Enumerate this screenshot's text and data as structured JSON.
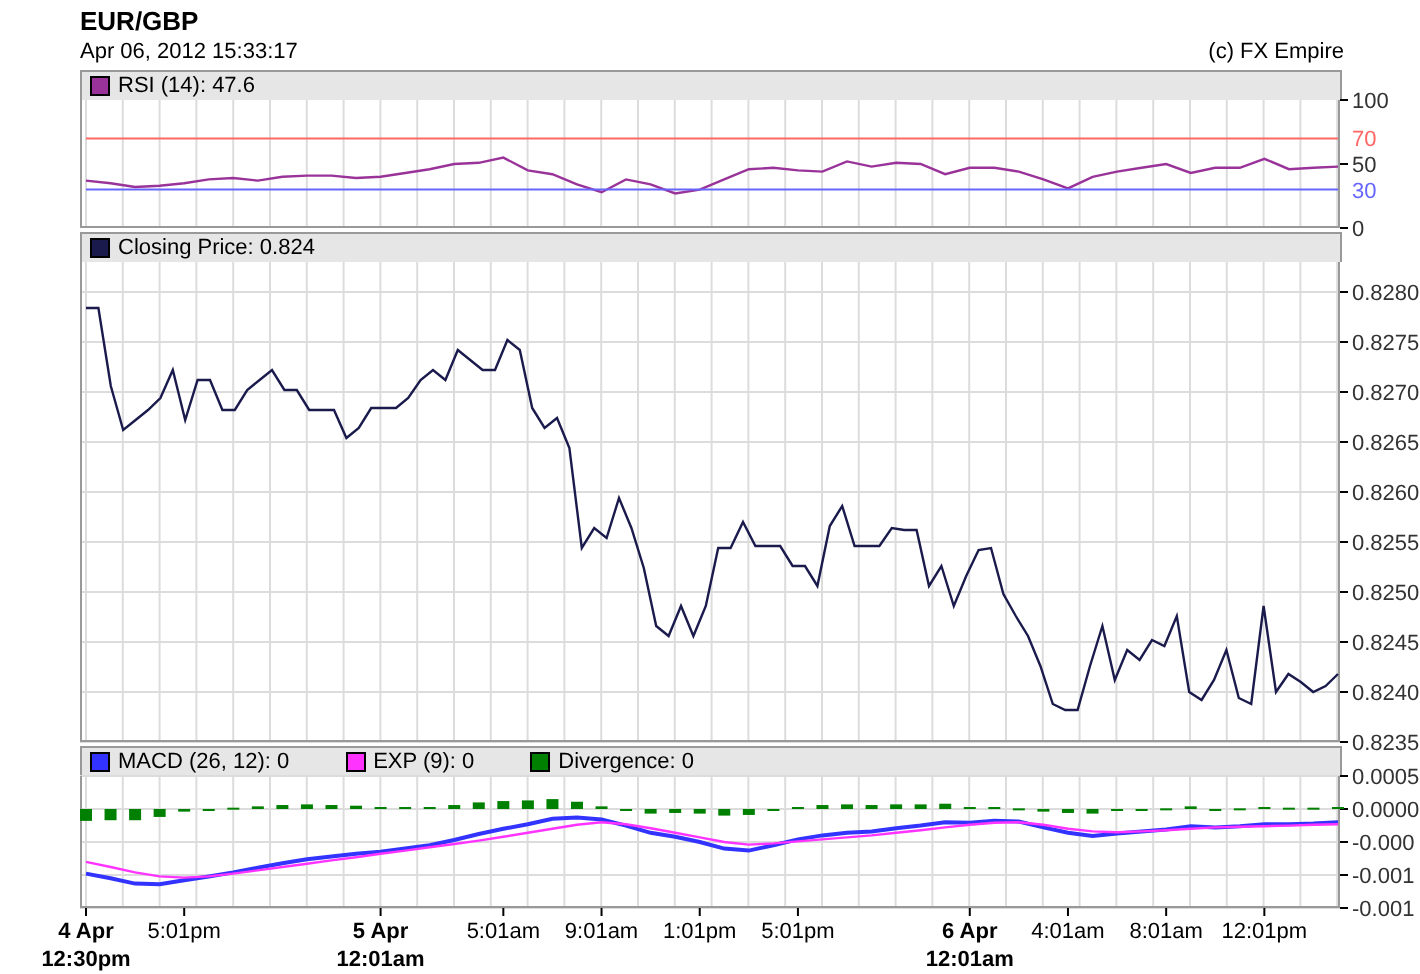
{
  "header": {
    "title": "EUR/GBP",
    "timestamp": "Apr 06, 2012 15:33:17",
    "copyright": "(c) FX Empire"
  },
  "panels": [
    {
      "chart_data": {
        "type": "line",
        "grid": true,
        "ylim": [
          0,
          100
        ],
        "yticks": [
          0,
          30,
          50,
          70,
          100
        ],
        "series": [
          {
            "name": "RSI (14): 47.6",
            "color": "#993399",
            "values": [
              37,
              35,
              32,
              33,
              35,
              38,
              39,
              37,
              40,
              41,
              41,
              39,
              40,
              43,
              46,
              50,
              51,
              55,
              45,
              42,
              34,
              28,
              38,
              34,
              27,
              30,
              38,
              46,
              47,
              45,
              44,
              52,
              48,
              51,
              50,
              42,
              47,
              47,
              44,
              38,
              31,
              40,
              44,
              47,
              50,
              43,
              47,
              47,
              54,
              46,
              47,
              48
            ]
          },
          {
            "color": "#ff6666",
            "values": [
              70,
              70,
              70,
              70,
              70,
              70,
              70,
              70,
              70,
              70,
              70,
              70,
              70,
              70,
              70,
              70,
              70,
              70,
              70,
              70,
              70,
              70,
              70,
              70,
              70,
              70,
              70,
              70,
              70,
              70,
              70,
              70,
              70,
              70,
              70,
              70,
              70,
              70,
              70,
              70,
              70,
              70,
              70,
              70,
              70,
              70,
              70,
              70,
              70,
              70,
              70,
              70
            ]
          },
          {
            "color": "#6666ff",
            "values": [
              30,
              30,
              30,
              30,
              30,
              30,
              30,
              30,
              30,
              30,
              30,
              30,
              30,
              30,
              30,
              30,
              30,
              30,
              30,
              30,
              30,
              30,
              30,
              30,
              30,
              30,
              30,
              30,
              30,
              30,
              30,
              30,
              30,
              30,
              30,
              30,
              30,
              30,
              30,
              30,
              30,
              30,
              30,
              30,
              30,
              30,
              30,
              30,
              30,
              30,
              30,
              30
            ]
          }
        ]
      }
    },
    {
      "chart_data": {
        "type": "line",
        "grid": true,
        "ylim": [
          0.8235,
          0.8283
        ],
        "yticks": [
          {
            "value": 0.828,
            "label": "0.8280"
          },
          {
            "value": 0.8275,
            "label": "0.8275"
          },
          {
            "value": 0.827,
            "label": "0.8270"
          },
          {
            "value": 0.8265,
            "label": "0.8265"
          },
          {
            "value": 0.826,
            "label": "0.8260"
          },
          {
            "value": 0.8255,
            "label": "0.8255"
          },
          {
            "value": 0.825,
            "label": "0.8250"
          },
          {
            "value": 0.8245,
            "label": "0.8245"
          },
          {
            "value": 0.824,
            "label": "0.8240"
          },
          {
            "value": 0.8235,
            "label": "0.8235"
          }
        ],
        "series": [
          {
            "name": "Closing Price: 0.824",
            "color": "#1a1a4d",
            "values": [
              0.82784,
              0.82784,
              0.82706,
              0.82662,
              0.82672,
              0.82682,
              0.82694,
              0.82722,
              0.82672,
              0.82712,
              0.82712,
              0.82682,
              0.82682,
              0.82702,
              0.82712,
              0.82722,
              0.82702,
              0.82702,
              0.82682,
              0.82682,
              0.82682,
              0.82654,
              0.82664,
              0.82684,
              0.82684,
              0.82684,
              0.82694,
              0.82712,
              0.82722,
              0.82712,
              0.82742,
              0.82732,
              0.82722,
              0.82722,
              0.82752,
              0.82742,
              0.82684,
              0.82664,
              0.82674,
              0.82644,
              0.82544,
              0.82564,
              0.82554,
              0.82594,
              0.82564,
              0.82524,
              0.82466,
              0.82456,
              0.82486,
              0.82456,
              0.82486,
              0.82544,
              0.82544,
              0.8257,
              0.82546,
              0.82546,
              0.82546,
              0.82526,
              0.82526,
              0.82506,
              0.82566,
              0.82586,
              0.82546,
              0.82546,
              0.82546,
              0.82564,
              0.82562,
              0.82562,
              0.82506,
              0.82526,
              0.82486,
              0.82516,
              0.82542,
              0.82544,
              0.82498,
              0.82476,
              0.82456,
              0.82426,
              0.82388,
              0.82382,
              0.82382,
              0.82426,
              0.82466,
              0.82412,
              0.82442,
              0.82432,
              0.82452,
              0.82446,
              0.82476,
              0.824,
              0.82392,
              0.82412,
              0.82442,
              0.82394,
              0.82388,
              0.82486,
              0.824,
              0.82418,
              0.8241,
              0.824,
              0.82406,
              0.82418
            ]
          }
        ]
      }
    },
    {
      "chart_data": {
        "type": "line",
        "grid": true,
        "ylim": [
          -0.0015,
          0.0005
        ],
        "categories": [
          "4 Apr\n12:30pm",
          null,
          null,
          null,
          "5:01pm",
          null,
          null,
          null,
          null,
          null,
          null,
          null,
          "5 Apr\n12:01am",
          null,
          null,
          null,
          null,
          "5:01am",
          null,
          null,
          null,
          "9:01am",
          null,
          null,
          null,
          "1:01pm",
          null,
          null,
          null,
          "5:01pm",
          null,
          null,
          null,
          null,
          null,
          null,
          "6 Apr\n12:01am",
          null,
          null,
          null,
          "4:01am",
          null,
          null,
          null,
          "8:01am",
          null,
          null,
          null,
          "12:01pm",
          null,
          null,
          null
        ],
        "yticks": [
          {
            "value": 0.0005,
            "label": "0.0005"
          },
          {
            "value": 0,
            "label": "0.0000"
          },
          {
            "value": -0.0005,
            "label": "-0.000"
          },
          {
            "value": -0.001,
            "label": "-0.001"
          },
          {
            "value": -0.0015,
            "label": "-0.001"
          }
        ],
        "series": [
          {
            "name": "MACD (26, 12): 0",
            "color": "#3333ff",
            "type": "line",
            "values": [
              -0.00098,
              -0.00105,
              -0.00113,
              -0.00114,
              -0.00108,
              -0.00102,
              -0.00096,
              -0.00089,
              -0.00082,
              -0.00076,
              -0.00072,
              -0.00068,
              -0.00065,
              -0.0006,
              -0.00055,
              -0.00047,
              -0.00038,
              -0.0003,
              -0.00023,
              -0.00015,
              -0.00013,
              -0.00016,
              -0.00025,
              -0.00036,
              -0.00042,
              -0.0005,
              -0.0006,
              -0.00063,
              -0.00055,
              -0.00046,
              -0.0004,
              -0.00036,
              -0.00034,
              -0.00029,
              -0.00025,
              -0.0002,
              -0.00021,
              -0.00018,
              -0.00019,
              -0.00028,
              -0.00036,
              -0.00041,
              -0.00037,
              -0.00034,
              -0.00031,
              -0.00026,
              -0.00028,
              -0.00026,
              -0.00023,
              -0.00023,
              -0.00022,
              -0.0002
            ]
          },
          {
            "name": "EXP (9): 0",
            "color": "#ff33ff",
            "type": "line",
            "values": [
              -0.0008,
              -0.00088,
              -0.00096,
              -0.00102,
              -0.00104,
              -0.00102,
              -0.00098,
              -0.00093,
              -0.00088,
              -0.00083,
              -0.00078,
              -0.00073,
              -0.00068,
              -0.00063,
              -0.00058,
              -0.00053,
              -0.00048,
              -0.00042,
              -0.00036,
              -0.0003,
              -0.00024,
              -0.0002,
              -0.00023,
              -0.00029,
              -0.00036,
              -0.00043,
              -0.0005,
              -0.00054,
              -0.00052,
              -0.00049,
              -0.00046,
              -0.00043,
              -0.0004,
              -0.00036,
              -0.00032,
              -0.00028,
              -0.00024,
              -0.00021,
              -0.0002,
              -0.00024,
              -0.0003,
              -0.00034,
              -0.00035,
              -0.00034,
              -0.00032,
              -0.0003,
              -0.00028,
              -0.00027,
              -0.00026,
              -0.00025,
              -0.00024,
              -0.00023
            ]
          },
          {
            "name": "Divergence: 0",
            "color": "#008000",
            "type": "bar",
            "values": [
              -0.00018,
              -0.00017,
              -0.00017,
              -0.00012,
              -4e-05,
              0,
              2e-05,
              4e-05,
              6e-05,
              7e-05,
              6e-05,
              5e-05,
              3e-05,
              3e-05,
              3e-05,
              6e-05,
              0.0001,
              0.00012,
              0.00013,
              0.00015,
              0.00011,
              4e-05,
              -2e-05,
              -7e-05,
              -6e-05,
              -7e-05,
              -0.0001,
              -9e-05,
              -3e-05,
              3e-05,
              6e-05,
              7e-05,
              6e-05,
              7e-05,
              7e-05,
              8e-05,
              3e-05,
              3e-05,
              1e-05,
              -4e-05,
              -6e-05,
              -7e-05,
              -2e-05,
              0,
              1e-05,
              4e-05,
              0,
              1e-05,
              3e-05,
              2e-05,
              2e-05,
              3e-05
            ]
          }
        ]
      }
    }
  ]
}
